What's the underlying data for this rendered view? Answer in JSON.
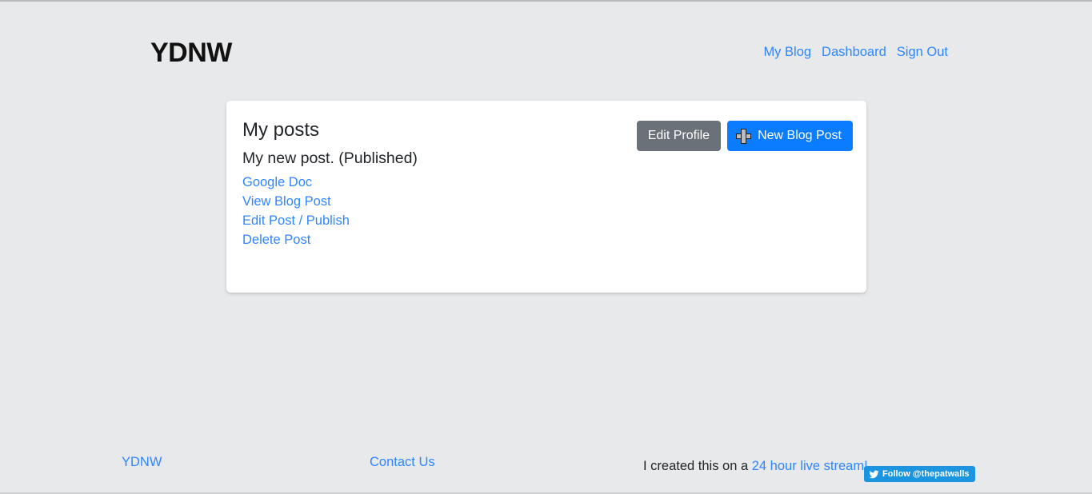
{
  "header": {
    "brand": "YDNW",
    "nav": [
      {
        "label": "My Blog",
        "name": "nav-link-my-blog"
      },
      {
        "label": "Dashboard",
        "name": "nav-link-dashboard"
      },
      {
        "label": "Sign Out",
        "name": "nav-link-sign-out"
      }
    ]
  },
  "card": {
    "title": "My posts",
    "edit_profile_label": "Edit Profile",
    "new_post_label": "New Blog Post",
    "new_post_icon": "plus-icon",
    "post": {
      "title": "My new post. (Published)",
      "links": [
        {
          "label": "Google Doc"
        },
        {
          "label": "View Blog Post"
        },
        {
          "label": "Edit Post / Publish"
        },
        {
          "label": "Delete Post"
        }
      ]
    }
  },
  "footer": {
    "brand": "YDNW",
    "contact": "Contact Us",
    "credit_prefix": "I created this on a ",
    "credit_link": "24 hour live stream!",
    "twitter": {
      "icon": "twitter-bird-icon",
      "label": "Follow @thepatwalls"
    }
  },
  "colors": {
    "page_background": "#e8e9ea",
    "card_background": "#ffffff",
    "link_blue": "#2f86ff",
    "primary_button": "#0a7cff",
    "secondary_button": "#6b7178",
    "twitter_blue": "#1b95e0",
    "text": "#212529"
  }
}
